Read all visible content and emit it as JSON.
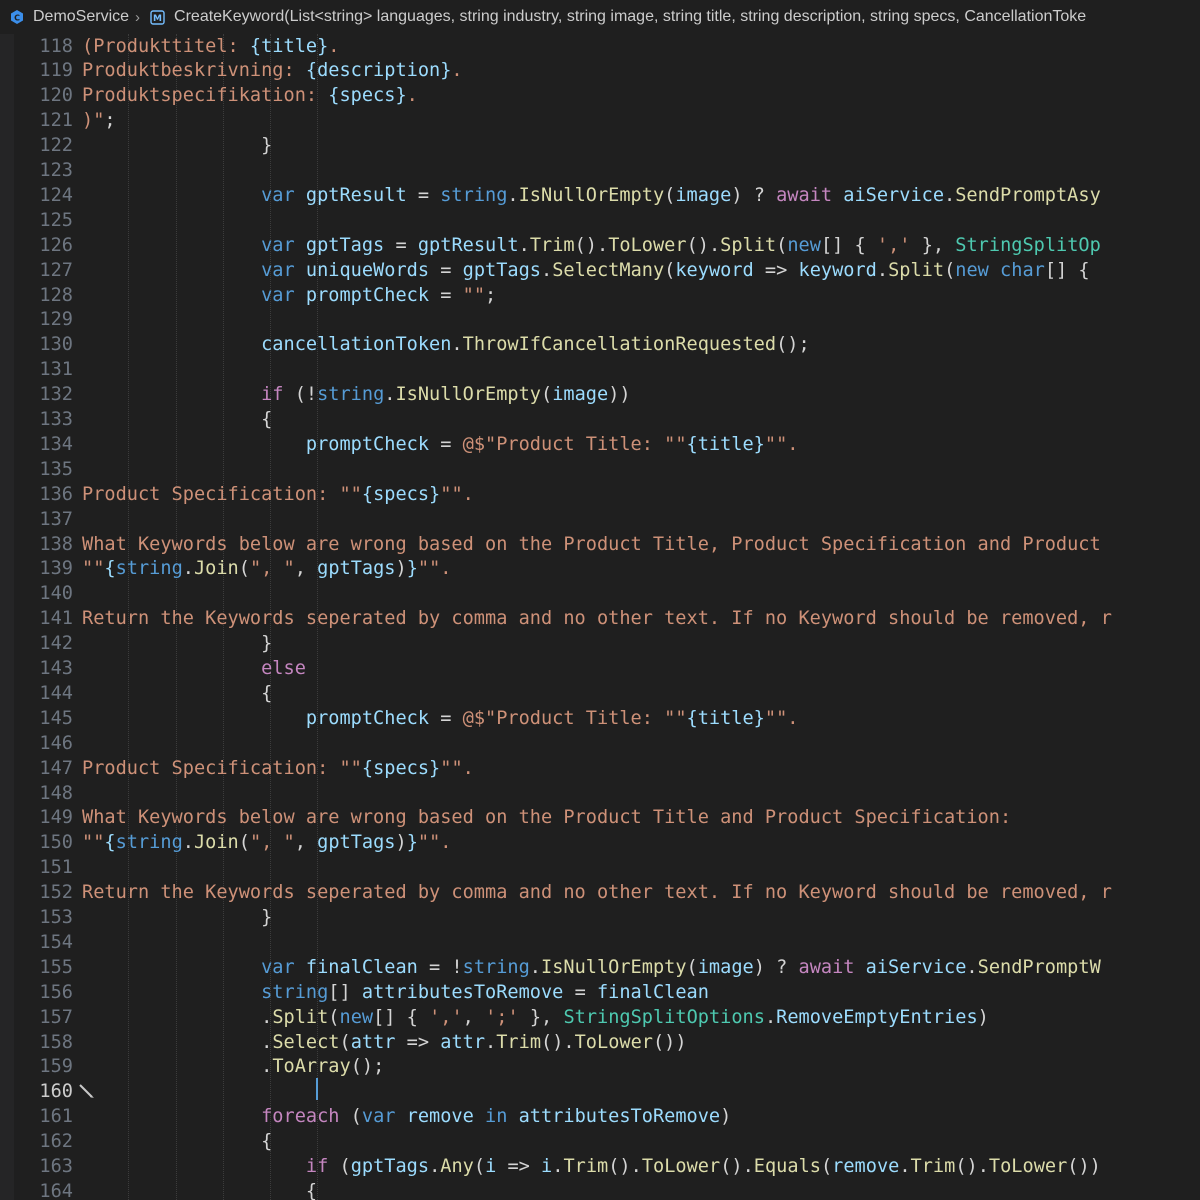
{
  "breadcrumb": {
    "project": "DemoService",
    "separator": "›",
    "method": "CreateKeyword(List<string> languages, string industry, string image, string title, string description, string specs, CancellationToke"
  },
  "editor": {
    "active_line": 160,
    "lines": [
      {
        "n": "118",
        "segs": [
          [
            "st",
            "(Produkttitel: "
          ],
          [
            "vr",
            "{title}"
          ],
          [
            "st",
            "."
          ]
        ]
      },
      {
        "n": "119",
        "segs": [
          [
            "st",
            "Produktbeskrivning: "
          ],
          [
            "vr",
            "{description}"
          ],
          [
            "st",
            "."
          ]
        ]
      },
      {
        "n": "120",
        "segs": [
          [
            "st",
            "Produktspecifikation: "
          ],
          [
            "vr",
            "{specs}"
          ],
          [
            "st",
            "."
          ]
        ]
      },
      {
        "n": "121",
        "segs": [
          [
            "st",
            ")\""
          ],
          [
            "op",
            ";"
          ]
        ]
      },
      {
        "n": "122",
        "segs": [
          [
            "op",
            "                }"
          ]
        ]
      },
      {
        "n": "123",
        "segs": []
      },
      {
        "n": "124",
        "segs": [
          [
            "kw",
            "                var "
          ],
          [
            "vr",
            "gptResult"
          ],
          [
            "op",
            " = "
          ],
          [
            "kw",
            "string"
          ],
          [
            "op",
            "."
          ],
          [
            "fn",
            "IsNullOrEmpty"
          ],
          [
            "op",
            "("
          ],
          [
            "vr",
            "image"
          ],
          [
            "op",
            ") ? "
          ],
          [
            "ctl",
            "await "
          ],
          [
            "vr",
            "aiService"
          ],
          [
            "op",
            "."
          ],
          [
            "fn",
            "SendPromptAsy"
          ]
        ]
      },
      {
        "n": "125",
        "segs": []
      },
      {
        "n": "126",
        "segs": [
          [
            "kw",
            "                var "
          ],
          [
            "vr",
            "gptTags"
          ],
          [
            "op",
            " = "
          ],
          [
            "vr",
            "gptResult"
          ],
          [
            "op",
            "."
          ],
          [
            "fn",
            "Trim"
          ],
          [
            "op",
            "()."
          ],
          [
            "fn",
            "ToLower"
          ],
          [
            "op",
            "()."
          ],
          [
            "fn",
            "Split"
          ],
          [
            "op",
            "("
          ],
          [
            "kw",
            "new"
          ],
          [
            "op",
            "[] { "
          ],
          [
            "st",
            "','"
          ],
          [
            "op",
            " }, "
          ],
          [
            "ty",
            "StringSplitOp"
          ]
        ]
      },
      {
        "n": "127",
        "segs": [
          [
            "kw",
            "                var "
          ],
          [
            "vr",
            "uniqueWords"
          ],
          [
            "op",
            " = "
          ],
          [
            "vr",
            "gptTags"
          ],
          [
            "op",
            "."
          ],
          [
            "fn",
            "SelectMany"
          ],
          [
            "op",
            "("
          ],
          [
            "vr",
            "keyword"
          ],
          [
            "op",
            " => "
          ],
          [
            "vr",
            "keyword"
          ],
          [
            "op",
            "."
          ],
          [
            "fn",
            "Split"
          ],
          [
            "op",
            "("
          ],
          [
            "kw",
            "new char"
          ],
          [
            "op",
            "[] {"
          ]
        ]
      },
      {
        "n": "128",
        "segs": [
          [
            "kw",
            "                var "
          ],
          [
            "vr",
            "promptCheck"
          ],
          [
            "op",
            " = "
          ],
          [
            "st",
            "\"\""
          ],
          [
            "op",
            ";"
          ]
        ]
      },
      {
        "n": "129",
        "segs": []
      },
      {
        "n": "130",
        "segs": [
          [
            "vr",
            "                cancellationToken"
          ],
          [
            "op",
            "."
          ],
          [
            "fn",
            "ThrowIfCancellationRequested"
          ],
          [
            "op",
            "();"
          ]
        ]
      },
      {
        "n": "131",
        "segs": []
      },
      {
        "n": "132",
        "segs": [
          [
            "ctl",
            "                if "
          ],
          [
            "op",
            "(!"
          ],
          [
            "kw",
            "string"
          ],
          [
            "op",
            "."
          ],
          [
            "fn",
            "IsNullOrEmpty"
          ],
          [
            "op",
            "("
          ],
          [
            "vr",
            "image"
          ],
          [
            "op",
            "))"
          ]
        ]
      },
      {
        "n": "133",
        "segs": [
          [
            "op",
            "                {"
          ]
        ]
      },
      {
        "n": "134",
        "segs": [
          [
            "vr",
            "                    promptCheck"
          ],
          [
            "op",
            " = "
          ],
          [
            "st",
            "@$\"Product Title: \"\""
          ],
          [
            "vr",
            "{title}"
          ],
          [
            "st",
            "\"\"."
          ]
        ]
      },
      {
        "n": "135",
        "segs": []
      },
      {
        "n": "136",
        "segs": [
          [
            "st",
            "Product Specification: \"\""
          ],
          [
            "vr",
            "{specs}"
          ],
          [
            "st",
            "\"\"."
          ]
        ]
      },
      {
        "n": "137",
        "segs": []
      },
      {
        "n": "138",
        "segs": [
          [
            "st",
            "What Keywords below are wrong based on the Product Title, Product Specification and Product"
          ]
        ]
      },
      {
        "n": "139",
        "segs": [
          [
            "st",
            "\"\""
          ],
          [
            "vr",
            "{"
          ],
          [
            "kw",
            "string"
          ],
          [
            "op",
            "."
          ],
          [
            "fn",
            "Join"
          ],
          [
            "op",
            "("
          ],
          [
            "st",
            "\", \""
          ],
          [
            "op",
            ", "
          ],
          [
            "vr",
            "gptTags"
          ],
          [
            "op",
            ")"
          ],
          [
            "vr",
            "}"
          ],
          [
            "st",
            "\"\"."
          ]
        ]
      },
      {
        "n": "140",
        "segs": []
      },
      {
        "n": "141",
        "segs": [
          [
            "st",
            "Return the Keywords seperated by comma and no other text. If no Keyword should be removed, r"
          ]
        ]
      },
      {
        "n": "142",
        "segs": [
          [
            "op",
            "                }"
          ]
        ]
      },
      {
        "n": "143",
        "segs": [
          [
            "ctl",
            "                else"
          ]
        ]
      },
      {
        "n": "144",
        "segs": [
          [
            "op",
            "                {"
          ]
        ]
      },
      {
        "n": "145",
        "segs": [
          [
            "vr",
            "                    promptCheck"
          ],
          [
            "op",
            " = "
          ],
          [
            "st",
            "@$\"Product Title: \"\""
          ],
          [
            "vr",
            "{title}"
          ],
          [
            "st",
            "\"\"."
          ]
        ]
      },
      {
        "n": "146",
        "segs": []
      },
      {
        "n": "147",
        "segs": [
          [
            "st",
            "Product Specification: \"\""
          ],
          [
            "vr",
            "{specs}"
          ],
          [
            "st",
            "\"\"."
          ]
        ]
      },
      {
        "n": "148",
        "segs": []
      },
      {
        "n": "149",
        "segs": [
          [
            "st",
            "What Keywords below are wrong based on the Product Title and Product Specification:"
          ]
        ]
      },
      {
        "n": "150",
        "segs": [
          [
            "st",
            "\"\""
          ],
          [
            "vr",
            "{"
          ],
          [
            "kw",
            "string"
          ],
          [
            "op",
            "."
          ],
          [
            "fn",
            "Join"
          ],
          [
            "op",
            "("
          ],
          [
            "st",
            "\", \""
          ],
          [
            "op",
            ", "
          ],
          [
            "vr",
            "gptTags"
          ],
          [
            "op",
            ")"
          ],
          [
            "vr",
            "}"
          ],
          [
            "st",
            "\"\"."
          ]
        ]
      },
      {
        "n": "151",
        "segs": []
      },
      {
        "n": "152",
        "segs": [
          [
            "st",
            "Return the Keywords seperated by comma and no other text. If no Keyword should be removed, r"
          ]
        ]
      },
      {
        "n": "153",
        "segs": [
          [
            "op",
            "                }"
          ]
        ]
      },
      {
        "n": "154",
        "segs": []
      },
      {
        "n": "155",
        "segs": [
          [
            "kw",
            "                var "
          ],
          [
            "vr",
            "finalClean"
          ],
          [
            "op",
            " = !"
          ],
          [
            "kw",
            "string"
          ],
          [
            "op",
            "."
          ],
          [
            "fn",
            "IsNullOrEmpty"
          ],
          [
            "op",
            "("
          ],
          [
            "vr",
            "image"
          ],
          [
            "op",
            ") ? "
          ],
          [
            "ctl",
            "await "
          ],
          [
            "vr",
            "aiService"
          ],
          [
            "op",
            "."
          ],
          [
            "fn",
            "SendPromptW"
          ]
        ]
      },
      {
        "n": "156",
        "segs": [
          [
            "kw",
            "                string"
          ],
          [
            "op",
            "[] "
          ],
          [
            "vr",
            "attributesToRemove"
          ],
          [
            "op",
            " = "
          ],
          [
            "vr",
            "finalClean"
          ]
        ]
      },
      {
        "n": "157",
        "segs": [
          [
            "op",
            "                ."
          ],
          [
            "fn",
            "Split"
          ],
          [
            "op",
            "("
          ],
          [
            "kw",
            "new"
          ],
          [
            "op",
            "[] { "
          ],
          [
            "st",
            "','"
          ],
          [
            "op",
            ", "
          ],
          [
            "st",
            "';'"
          ],
          [
            "op",
            " }, "
          ],
          [
            "ty",
            "StringSplitOptions"
          ],
          [
            "op",
            "."
          ],
          [
            "vr",
            "RemoveEmptyEntries"
          ],
          [
            "op",
            ")"
          ]
        ]
      },
      {
        "n": "158",
        "segs": [
          [
            "op",
            "                ."
          ],
          [
            "fn",
            "Select"
          ],
          [
            "op",
            "("
          ],
          [
            "vr",
            "attr"
          ],
          [
            "op",
            " => "
          ],
          [
            "vr",
            "attr"
          ],
          [
            "op",
            "."
          ],
          [
            "fn",
            "Trim"
          ],
          [
            "op",
            "()."
          ],
          [
            "fn",
            "ToLower"
          ],
          [
            "op",
            "())"
          ]
        ]
      },
      {
        "n": "159",
        "segs": [
          [
            "op",
            "                ."
          ],
          [
            "fn",
            "ToArray"
          ],
          [
            "op",
            "();"
          ]
        ]
      },
      {
        "n": "160",
        "segs": []
      },
      {
        "n": "161",
        "segs": [
          [
            "ctl",
            "                foreach "
          ],
          [
            "op",
            "("
          ],
          [
            "kw",
            "var "
          ],
          [
            "vr",
            "remove"
          ],
          [
            "kw",
            " in "
          ],
          [
            "vr",
            "attributesToRemove"
          ],
          [
            "op",
            ")"
          ]
        ]
      },
      {
        "n": "162",
        "segs": [
          [
            "op",
            "                {"
          ]
        ]
      },
      {
        "n": "163",
        "segs": [
          [
            "ctl",
            "                    if "
          ],
          [
            "op",
            "("
          ],
          [
            "vr",
            "gptTags"
          ],
          [
            "op",
            "."
          ],
          [
            "fn",
            "Any"
          ],
          [
            "op",
            "("
          ],
          [
            "vr",
            "i"
          ],
          [
            "op",
            " => "
          ],
          [
            "vr",
            "i"
          ],
          [
            "op",
            "."
          ],
          [
            "fn",
            "Trim"
          ],
          [
            "op",
            "()."
          ],
          [
            "fn",
            "ToLower"
          ],
          [
            "op",
            "()."
          ],
          [
            "fn",
            "Equals"
          ],
          [
            "op",
            "("
          ],
          [
            "vr",
            "remove"
          ],
          [
            "op",
            "."
          ],
          [
            "fn",
            "Trim"
          ],
          [
            "op",
            "()."
          ],
          [
            "fn",
            "ToLower"
          ],
          [
            "op",
            "())"
          ]
        ]
      },
      {
        "n": "164",
        "segs": [
          [
            "op",
            "                    {"
          ]
        ]
      }
    ]
  }
}
